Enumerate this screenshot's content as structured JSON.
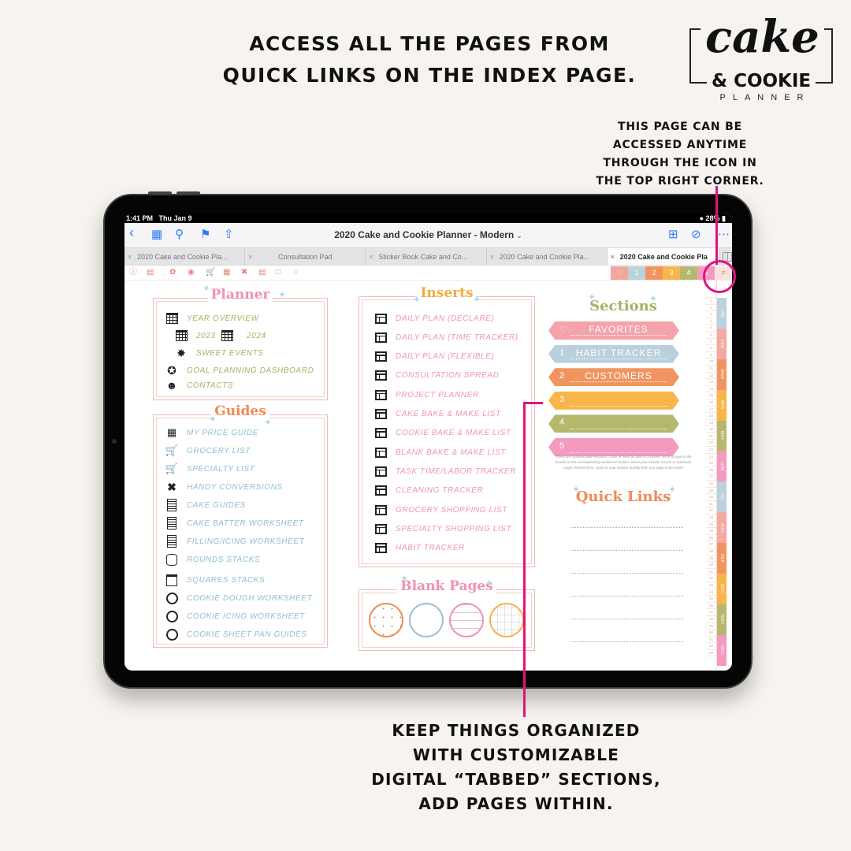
{
  "marketing": {
    "headline_line1": "ACCESS ALL THE PAGES FROM",
    "headline_line2": "QUICK LINKS ON THE INDEX PAGE.",
    "side_note_lines": [
      "THIS PAGE CAN BE",
      "ACCESSED ANYTIME",
      "THROUGH THE ICON IN",
      "THE TOP RIGHT CORNER."
    ],
    "bottom_note_lines": [
      "KEEP THINGS ORGANIZED",
      "WITH CUSTOMIZABLE",
      "DIGITAL “TABBED” SECTIONS,",
      "ADD PAGES WITHIN."
    ],
    "accent_color": "#e3127f"
  },
  "logo": {
    "script": "cake",
    "subtitle": "& COOKIE",
    "tagline": "PLANNER"
  },
  "status_bar": {
    "time": "1:41 PM",
    "date": "Thu Jan 9",
    "battery": "28%"
  },
  "app": {
    "document_title": "2020 Cake and Cookie Planner - Modern",
    "nav_icons": [
      "back-icon",
      "grid-icon",
      "search-icon",
      "bookmark-icon",
      "share-icon"
    ],
    "right_icons": [
      "add-page-icon",
      "pencil-circle-icon",
      "more-icon"
    ],
    "tabs": [
      {
        "label": "2020 Cake and Cookie Pla...",
        "active": false
      },
      {
        "label": "Consultation Pad",
        "active": false
      },
      {
        "label": "Sticker Book Cake and Co...",
        "active": false
      },
      {
        "label": "2020 Cake and Cookie Pla...",
        "active": false
      },
      {
        "label": "2020 Cake and Cookie Pla",
        "active": true
      }
    ],
    "toolstrip_icons": [
      "help-icon",
      "table-icon",
      "goal-icon",
      "contacts-icon",
      "cart-icon",
      "price-guide-icon",
      "whisk-icon",
      "cake-layers-icon",
      "square-icon",
      "circle-icon"
    ],
    "section_tabs": [
      {
        "label": "♡",
        "color": "#f1a59b"
      },
      {
        "label": "1",
        "color": "#b9d2dc"
      },
      {
        "label": "2",
        "color": "#f19560"
      },
      {
        "label": "3",
        "color": "#f7b54a"
      },
      {
        "label": "4",
        "color": "#b5b96e"
      },
      {
        "label": "5",
        "color": "#f59abf"
      },
      {
        "label": "≡",
        "color": "#fbe3dc"
      }
    ]
  },
  "planner": {
    "title": "Planner",
    "items": [
      {
        "icon": "calendar-icon",
        "label": "YEAR OVERVIEW"
      },
      {
        "icon": "calendar-icon",
        "label": "2023"
      },
      {
        "icon": "calendar-icon",
        "label": "2024"
      },
      {
        "icon": "party-popper-icon",
        "label": "SWEET EVENTS"
      },
      {
        "icon": "goal-badge-icon",
        "label": "GOAL PLANNING DASHBOARD"
      },
      {
        "icon": "person-circle-icon",
        "label": "CONTACTS"
      }
    ]
  },
  "guides": {
    "title": "Guides",
    "items": [
      {
        "icon": "price-guide-icon",
        "label": "MY PRICE GUIDE"
      },
      {
        "icon": "cart-icon",
        "label": "GROCERY LIST"
      },
      {
        "icon": "cart-icon",
        "label": "SPECIALTY LIST"
      },
      {
        "icon": "whisk-spoon-icon",
        "label": "HANDY CONVERSIONS"
      },
      {
        "icon": "cake-layers-icon",
        "label": "CAKE GUIDES"
      },
      {
        "icon": "cake-layers-icon",
        "label": "CAKE BATTER WORKSHEET"
      },
      {
        "icon": "cake-layers-icon",
        "label": "FILLING/ICING WORKSHEET"
      },
      {
        "icon": "round-cake-icon",
        "label": "ROUNDS STACKS"
      },
      {
        "icon": "square-cake-icon",
        "label": "SQUARES STACKS"
      },
      {
        "icon": "cookie-icon",
        "label": "COOKIE DOUGH WORKSHEET"
      },
      {
        "icon": "cookie-icon",
        "label": "COOKIE ICING WORKSHEET"
      },
      {
        "icon": "cookie-icon",
        "label": "COOKIE SHEET PAN GUIDES"
      }
    ]
  },
  "inserts": {
    "title": "Inserts",
    "items": [
      "DAILY PLAN (DECLARE)",
      "DAILY PLAN (TIME TRACKER)",
      "DAILY PLAN (FLEXIBLE)",
      "CONSULTATION SPREAD",
      "PROJECT PLANNER",
      "CAKE BAKE & MAKE LIST",
      "COOKIE BAKE & MAKE LIST",
      "BLANK BAKE & MAKE LIST",
      "TASK TIME/LABOR TRACKER",
      "CLEANING TRACKER",
      "GROCERY SHOPPING LIST",
      "SPECIALTY SHOPPING LIST",
      "HABIT TRACKER"
    ]
  },
  "blank_pages": {
    "title": "Blank Pages",
    "styles": [
      {
        "name": "dot-grid",
        "color": "#ef8c4c"
      },
      {
        "name": "plain",
        "color": "#9fbccb"
      },
      {
        "name": "lined",
        "color": "#ef8fb6"
      },
      {
        "name": "grid",
        "color": "#f7b23c"
      }
    ]
  },
  "sections": {
    "title": "Sections",
    "items": [
      {
        "num": "♡",
        "label": "FAVORITES",
        "color": "#f5a2ab"
      },
      {
        "num": "1",
        "label": "HABIT TRACKER",
        "color": "#b9d1dc"
      },
      {
        "num": "2",
        "label": "CUSTOMERS",
        "color": "#f19560"
      },
      {
        "num": "3",
        "label": "",
        "color": "#f7b54a"
      },
      {
        "num": "4",
        "label": "",
        "color": "#b4b86d"
      },
      {
        "num": "5",
        "label": "",
        "color": "#f59abf"
      }
    ],
    "note": "These are customizable sections. Think of them as tabs in a binder! Write or type in the header to the corresponding numbered section. Insert your favorite inserts or notebook pages behind them. Jump to your section quickly from any page in the book!"
  },
  "quick_links": {
    "title": "Quick Links",
    "line_count": 6
  },
  "sidebar": {
    "week_numbers": [
      "1",
      "2",
      "3",
      "4",
      "5",
      "6",
      "7",
      "8",
      "9",
      "10",
      "11",
      "12",
      "13",
      "14",
      "15",
      "16",
      "17",
      "18",
      "19",
      "20",
      "21",
      "22",
      "23",
      "24",
      "25",
      "26",
      "27",
      "28",
      "29",
      "30",
      "31",
      "32",
      "33",
      "34",
      "35",
      "36",
      "37",
      "38",
      "39",
      "40",
      "41",
      "42",
      "43",
      "44",
      "45",
      "46",
      "47",
      "48",
      "49",
      "50",
      "51",
      "52",
      "53"
    ],
    "months": [
      {
        "label": "JAN",
        "color": "#b9d2dc"
      },
      {
        "label": "FEB",
        "color": "#f4a9a3"
      },
      {
        "label": "MAR",
        "color": "#f19560"
      },
      {
        "label": "APR",
        "color": "#f7b54a"
      },
      {
        "label": "MAY",
        "color": "#b5b96e"
      },
      {
        "label": "JUN",
        "color": "#f59abf"
      },
      {
        "label": "JUL",
        "color": "#b9d2dc"
      },
      {
        "label": "AUG",
        "color": "#f4a9a3"
      },
      {
        "label": "SEP",
        "color": "#f19560"
      },
      {
        "label": "OCT",
        "color": "#f7b54a"
      },
      {
        "label": "NOV",
        "color": "#b5b96e"
      },
      {
        "label": "DEC",
        "color": "#f59abf"
      }
    ]
  }
}
